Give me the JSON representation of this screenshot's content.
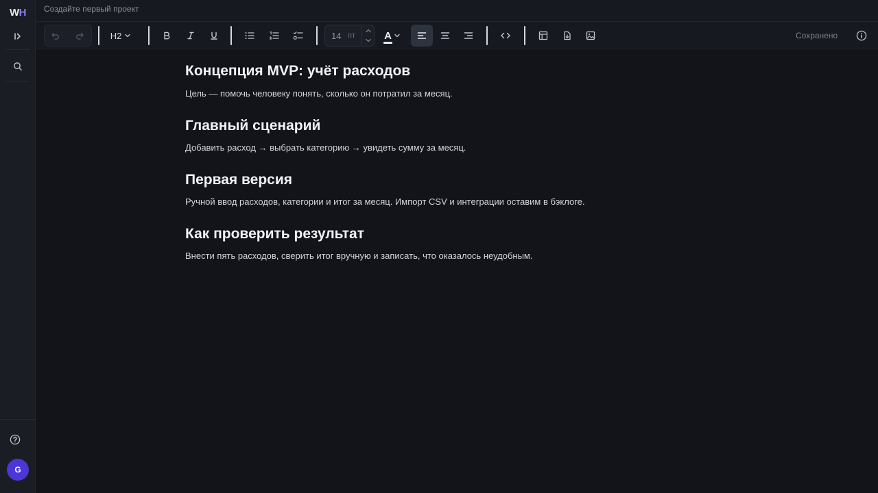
{
  "app": {
    "logo_w": "W",
    "logo_h": "H"
  },
  "sidebar": {
    "expand_icon": "sidebar-expand-icon",
    "search_icon": "search-icon",
    "help_icon": "help-icon",
    "avatar_letter": "G"
  },
  "topbar": {
    "project_placeholder": "Создайте первый проект"
  },
  "toolbar": {
    "heading_level": "H2",
    "font_size": "14",
    "font_size_unit": "пт",
    "text_color_glyph": "A",
    "status": "Сохранено",
    "active_alignment": "left"
  },
  "document": {
    "title": "Концепция MVP: учёт расходов",
    "sections": [
      {
        "text": "Цель — помочь человеку понять, сколько он потратил за месяц."
      },
      {
        "heading": "Главный сценарий",
        "text": "Добавить расход → выбрать категорию → увидеть сумму за месяц."
      },
      {
        "heading": "Первая версия",
        "text": "Ручной ввод расходов, категории и итог за месяц. Импорт CSV и интеграции оставим в бэклоге."
      },
      {
        "heading": "Как проверить результат",
        "text": "Внести пять расходов, сверить итог вручную и записать, что оказалось неудобным."
      }
    ]
  },
  "colors": {
    "accent": "#8b7ff0",
    "avatar": "#4b36d6",
    "background": "#13141a"
  }
}
